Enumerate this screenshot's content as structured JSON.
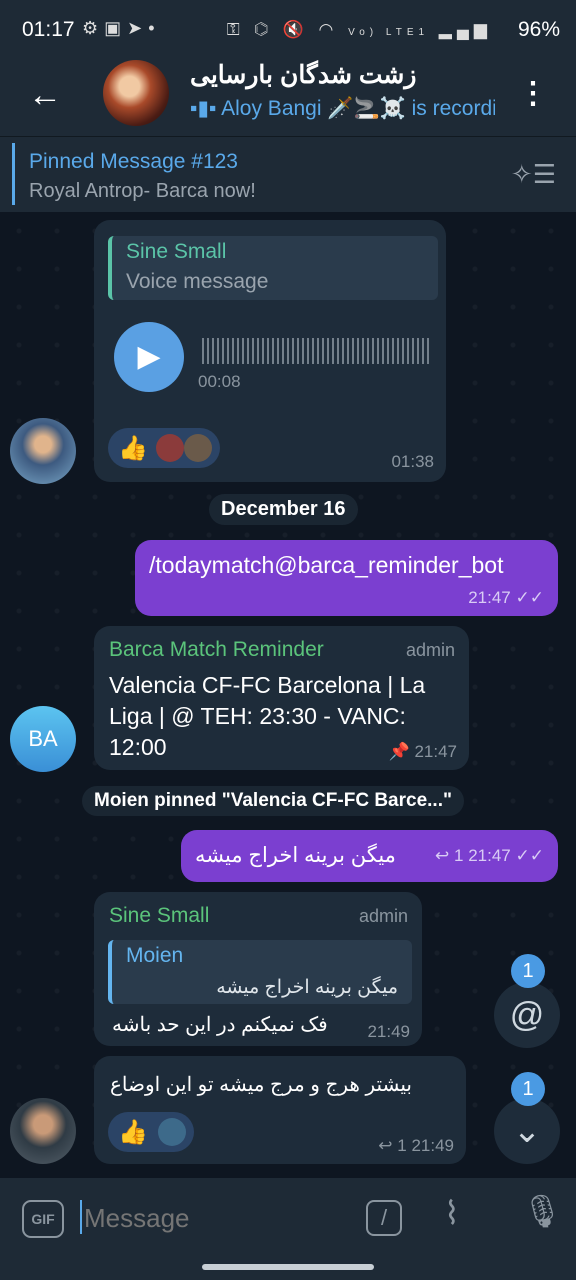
{
  "status_bar": {
    "time": "01:17",
    "battery": "96%",
    "network": "Vo) LTE1"
  },
  "header": {
    "title": "زشت شدگان بارسایی",
    "typing": "Aloy Bangi 🗡️🚬☠️ is recording"
  },
  "pinned": {
    "title": "Pinned Message #123",
    "text": "Royal Antrop- Barca now!"
  },
  "messages": {
    "voice": {
      "reply_name": "Sine Small",
      "reply_text": "Voice message",
      "duration": "00:08",
      "time": "01:38",
      "reaction": "👍"
    },
    "date_chip": "December 16",
    "cmd": {
      "text": "/todaymatch@barca_reminder_bot",
      "time": "21:47"
    },
    "bot": {
      "sender": "Barca Match Reminder",
      "role": "admin",
      "text": "Valencia CF-FC Barcelona | La Liga | @ TEH: 23:30 - VANC: 12:00",
      "time": "21:47",
      "avatar_initials": "BA"
    },
    "service": "Moien pinned \"Valencia CF-FC Barce...\"",
    "out2": {
      "text": "میگن برینه اخراج میشه",
      "replies": "1",
      "time": "21:47"
    },
    "reply_msg": {
      "sender": "Sine Small",
      "role": "admin",
      "quote_name": "Moien",
      "quote_text": "میگن برینه اخراج میشه",
      "text": "فک نمیکنم در این حد باشه",
      "time": "21:49"
    },
    "last": {
      "text": "بیشتر هرج و مرج میشه تو این اوضاع",
      "reaction": "👍",
      "replies": "1",
      "time": "21:49"
    }
  },
  "fabs": {
    "mention_badge": "1",
    "down_badge": "1"
  },
  "composer": {
    "placeholder": "Message",
    "gif_label": "GIF",
    "cmd_label": "/"
  },
  "colors": {
    "accent": "#5aa9ea",
    "outgoing": "#7b3fd0",
    "incoming": "#1e2c3a",
    "bg": "#0e1621"
  }
}
